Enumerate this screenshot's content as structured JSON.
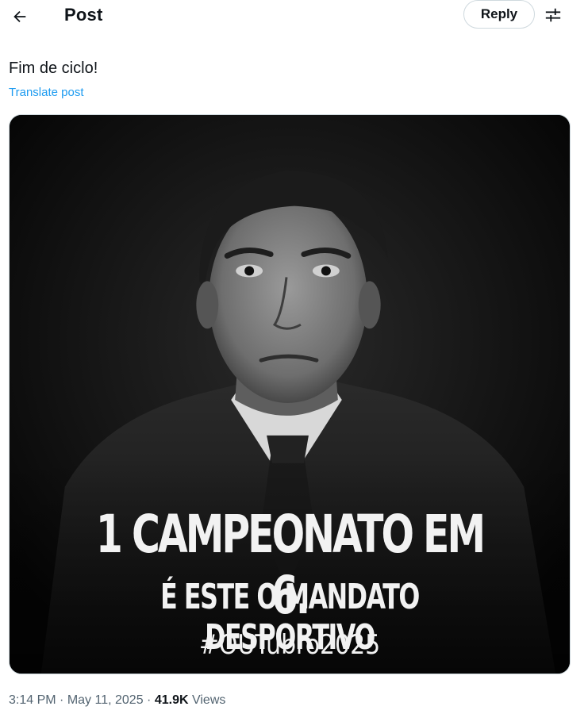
{
  "header": {
    "title": "Post",
    "reply_label": "Reply"
  },
  "post": {
    "text": "Fim de ciclo!",
    "translate_label": "Translate post",
    "image_text": {
      "line1": "1 CAMPEONATO EM 6.",
      "line2": "É ESTE O MANDATO DESPORTIVO",
      "hashtag": "#OUTubro2025"
    },
    "time": "3:14 PM",
    "separator": "·",
    "date": "May 11, 2025",
    "views_count": "41.9K",
    "views_label": "Views"
  },
  "icons": {
    "back": "arrow-left-icon",
    "settings": "sliders-icon"
  },
  "colors": {
    "accent": "#1d9bf0",
    "text": "#0f1419",
    "muted": "#536471",
    "border": "#cfd9de"
  }
}
